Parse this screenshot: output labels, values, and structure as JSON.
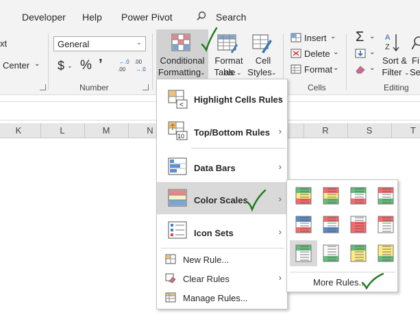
{
  "tabs": [
    "Developer",
    "Help",
    "Power Pivot"
  ],
  "search": {
    "label": "Search"
  },
  "ribbon": {
    "partial_left_top": "xt",
    "partial_left_mid": "Center",
    "number_format": "General",
    "currency_symbol": "$",
    "percent_symbol": "%",
    "comma_symbol": "’",
    "inc_decimal": ".00",
    "dec_decimal": ".00",
    "group_number": "Number",
    "conditional_formatting": [
      "Conditional",
      "Formatting"
    ],
    "format_as_table": [
      "Format as",
      "Table"
    ],
    "cell_styles": [
      "Cell",
      "Styles"
    ],
    "insert": "Insert",
    "delete": "Delete",
    "format": "Format",
    "group_cells": "Cells",
    "sort_filter": [
      "Sort &",
      "Filter"
    ],
    "find_select_partial": [
      "Fi",
      "Sel"
    ],
    "group_editing": "Editing"
  },
  "columns": [
    "K",
    "L",
    "M",
    "N",
    "R",
    "S",
    "T"
  ],
  "menu": {
    "highlight": "Highlight Cells Rules",
    "topbottom": "Top/Bottom Rules",
    "databars": "Data Bars",
    "colorscales": "Color Scales",
    "iconsets": "Icon Sets",
    "newrule": "New Rule...",
    "clearrules": "Clear Rules",
    "managerules": "Manage Rules..."
  },
  "submenu": {
    "more_rules": "More Rules..."
  },
  "colors": {
    "ribbon_bg": "#f3f3f3",
    "pressed": "#d2d2d2",
    "hover": "#d9d9d9",
    "check": "#1a7a1a"
  }
}
